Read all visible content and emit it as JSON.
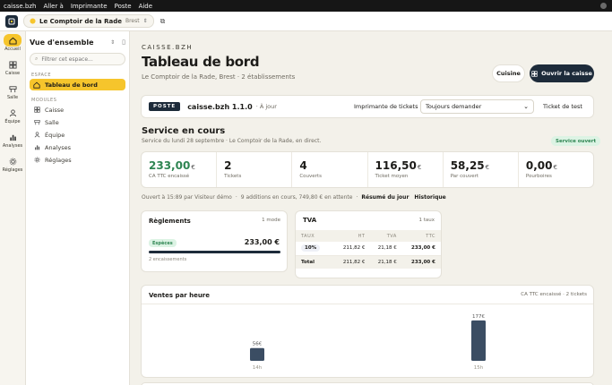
{
  "menubar": {
    "items": [
      "caisse.bzh",
      "Aller à",
      "Imprimante",
      "Poste",
      "Aide"
    ]
  },
  "appbar": {
    "store_name": "Le Comptoir de la Rade",
    "store_city": "Brest"
  },
  "rail": [
    {
      "label": "Accueil",
      "icon": "home-icon",
      "active": true
    },
    {
      "label": "Caisse",
      "icon": "grid-icon",
      "active": false
    },
    {
      "label": "Salle",
      "icon": "table-icon",
      "active": false
    },
    {
      "label": "Équipe",
      "icon": "team-icon",
      "active": false
    },
    {
      "label": "Analyses",
      "icon": "chart-icon",
      "active": false
    },
    {
      "label": "Réglages",
      "icon": "settings-icon",
      "active": false
    }
  ],
  "sidebar": {
    "title": "Vue d'ensemble",
    "search_placeholder": "Filtrer cet espace...",
    "section_space": "ESPACE",
    "active_item": "Tableau de bord",
    "section_modules": "MODULES",
    "modules": [
      "Caisse",
      "Salle",
      "Équipe",
      "Analyses",
      "Réglages"
    ]
  },
  "header": {
    "brand": "CAISSE.BZH",
    "title": "Tableau de bord",
    "subtitle": "Le Comptoir de la Rade, Brest · 2 établissements",
    "kitchen_button": "Cuisine",
    "open_register_button": "Ouvrir la caisse"
  },
  "printer": {
    "tag": "POSTE",
    "version": "caisse.bzh 1.1.0",
    "status": "· À jour",
    "label": "Imprimante de tickets",
    "selected": "Toujours demander",
    "test_button": "Ticket de test"
  },
  "service": {
    "title": "Service en cours",
    "subtitle": "Service du lundi 28 septembre · Le Comptoir de la Rade, en direct.",
    "badge": "Service ouvert"
  },
  "kpis": [
    {
      "value": "233,00",
      "unit": "€",
      "label": "CA TTC encaissé"
    },
    {
      "value": "2",
      "unit": "",
      "label": "Tickets"
    },
    {
      "value": "4",
      "unit": "",
      "label": "Couverts"
    },
    {
      "value": "116,50",
      "unit": "€",
      "label": "Ticket moyen"
    },
    {
      "value": "58,25",
      "unit": "€",
      "label": "Par couvert"
    },
    {
      "value": "0,00",
      "unit": "€",
      "label": "Pourboires"
    }
  ],
  "info": {
    "opened": "Ouvert à 15:89 par Visiteur démo",
    "pending": "9 additions en cours, 749,80 € en attente",
    "tab_summary": "Résumé du jour",
    "tab_history": "Historique"
  },
  "payments": {
    "title": "Règlements",
    "mode_count": "1 mode",
    "method": "Espèces",
    "amount": "233,00 €",
    "count": "2 encaissements"
  },
  "vat": {
    "title": "TVA",
    "rate_count": "1 taux",
    "headers": [
      "TAUX",
      "HT",
      "TVA",
      "TTC"
    ],
    "row": [
      "10%",
      "211,82 €",
      "21,18 €",
      "233,00 €"
    ],
    "total": [
      "Total",
      "211,82 €",
      "21,18 €",
      "233,00 €"
    ]
  },
  "hourly": {
    "title": "Ventes par heure",
    "meta": "CA TTC encaissé · 2 tickets"
  },
  "chart_data": {
    "type": "bar",
    "categories": [
      "14h",
      "15h"
    ],
    "values": [
      56,
      177
    ],
    "value_labels": [
      "56€",
      "177€"
    ],
    "ylim": [
      0,
      200
    ],
    "color": "#3b4d63"
  }
}
